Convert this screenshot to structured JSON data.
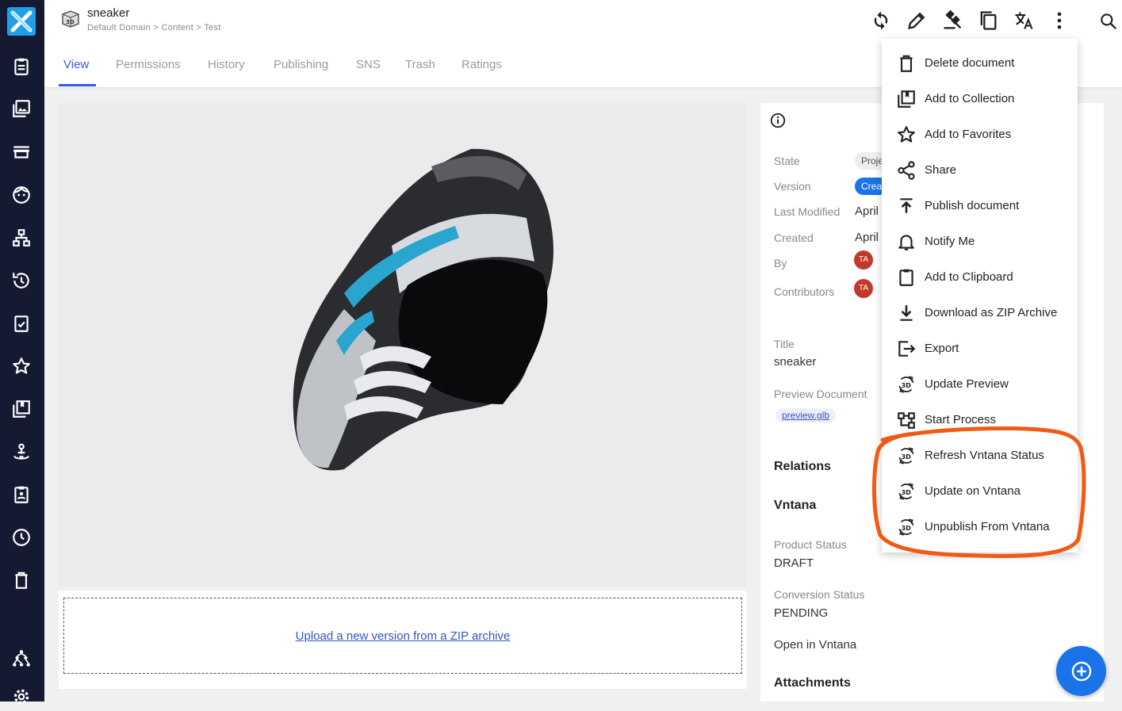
{
  "document": {
    "title": "sneaker",
    "breadcrumb": "Default Domain > Content > Test"
  },
  "tabs": [
    {
      "label": "View",
      "active": true
    },
    {
      "label": "Permissions"
    },
    {
      "label": "History"
    },
    {
      "label": "Publishing"
    },
    {
      "label": "SNS"
    },
    {
      "label": "Trash"
    },
    {
      "label": "Ratings"
    }
  ],
  "header_actions": [
    "refresh-icon",
    "edit-icon",
    "gavel-icon",
    "copy-icon",
    "translate-icon",
    "more-vert-icon",
    "search-icon"
  ],
  "sidebar_icons": [
    "clipboard-icon",
    "photo-library-icon",
    "store-icon",
    "face-icon",
    "hierarchy-icon",
    "history-icon",
    "task-icon",
    "star-icon",
    "collections-icon",
    "workflow-icon",
    "assignment-icon",
    "clock-icon",
    "trash-icon",
    "tree-icon",
    "settings-icon"
  ],
  "viewer": {
    "upload_link": "Upload a new version from a ZIP archive"
  },
  "metadata": {
    "state_label": "State",
    "state_value": "Proje",
    "version_label": "Version",
    "version_value": "Crea",
    "last_modified_label": "Last Modified",
    "last_modified_value": "April",
    "created_label": "Created",
    "created_value": "April",
    "by_label": "By",
    "by_initials": "TA",
    "contributors_label": "Contributors",
    "contributors_initials": "TA",
    "title_label": "Title",
    "title_value": "sneaker",
    "preview_label": "Preview Document",
    "preview_value": "preview.glb",
    "relations_heading": "Relations",
    "vntana_heading": "Vntana",
    "product_status_label": "Product Status",
    "product_status_value": "DRAFT",
    "conversion_status_label": "Conversion Status",
    "conversion_status_value": "PENDING",
    "open_in_vntana": "Open in Vntana",
    "attachments_heading": "Attachments"
  },
  "menu": {
    "items": [
      {
        "label": "Delete document",
        "icon": "delete-icon"
      },
      {
        "label": "Add to Collection",
        "icon": "add-collection-icon"
      },
      {
        "label": "Add to Favorites",
        "icon": "star-icon"
      },
      {
        "label": "Share",
        "icon": "share-icon"
      },
      {
        "label": "Publish document",
        "icon": "publish-icon"
      },
      {
        "label": "Notify Me",
        "icon": "bell-icon"
      },
      {
        "label": "Add to Clipboard",
        "icon": "clipboard-icon"
      },
      {
        "label": "Download as ZIP Archive",
        "icon": "download-icon"
      },
      {
        "label": "Export",
        "icon": "export-icon"
      },
      {
        "label": "Update Preview",
        "icon": "3d-rotation-icon"
      },
      {
        "label": "Start Process",
        "icon": "process-icon"
      },
      {
        "label": "Refresh Vntana Status",
        "icon": "3d-rotation-icon"
      },
      {
        "label": "Update on Vntana",
        "icon": "3d-rotation-icon"
      },
      {
        "label": "Unpublish From Vntana",
        "icon": "3d-rotation-icon"
      }
    ]
  },
  "colors": {
    "sidebar": "#151a32",
    "accent": "#3a5bd9",
    "highlight": "#f05a14",
    "fab": "#1a73e8"
  }
}
